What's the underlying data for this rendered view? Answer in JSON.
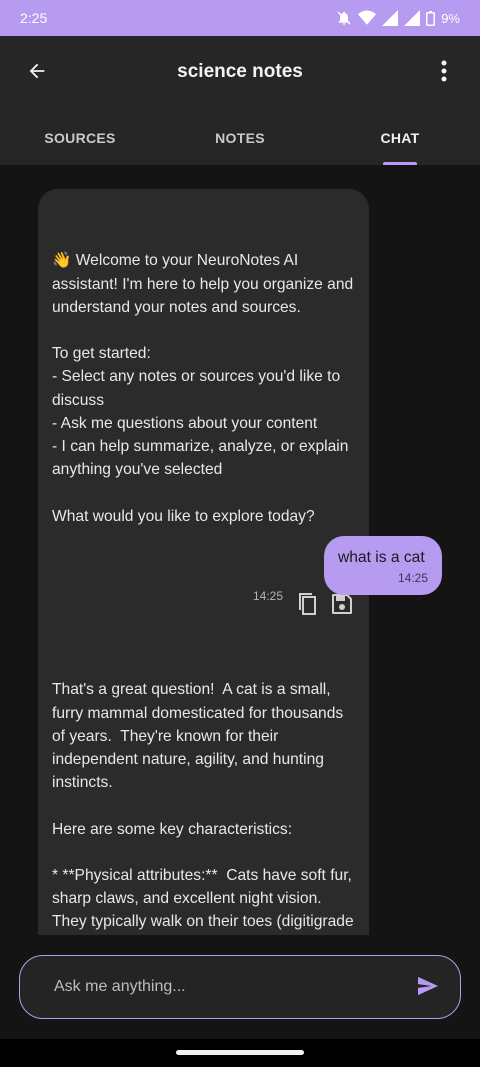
{
  "status_bar": {
    "time": "2:25",
    "battery": "9%"
  },
  "app_bar": {
    "title": "science notes",
    "back_icon": "arrow-back-icon",
    "menu_icon": "more-vert-icon"
  },
  "tabs": [
    {
      "label": "SOURCES",
      "active": false
    },
    {
      "label": "NOTES",
      "active": false
    },
    {
      "label": "CHAT",
      "active": true
    }
  ],
  "messages": [
    {
      "role": "assistant",
      "text": "👋 Welcome to your NeuroNotes AI assistant! I'm here to help you organize and understand your notes and sources.\n\nTo get started:\n- Select any notes or sources you'd like to discuss\n- Ask me questions about your content\n- I can help summarize, analyze, or explain anything you've selected\n\nWhat would you like to explore today?",
      "time": "14:25",
      "actions": [
        "copy-icon",
        "save-icon"
      ]
    },
    {
      "role": "user",
      "text": "what is a cat",
      "time": "14:25"
    },
    {
      "role": "assistant",
      "text": "That's a great question!  A cat is a small, furry mammal domesticated for thousands of years.  They're known for their independent nature, agility, and hunting instincts.\n\nHere are some key characteristics:\n\n* **Physical attributes:**  Cats have soft fur, sharp claws, and excellent night vision.  They typically walk on their toes (digitigrade locomotion).\n* **Behavior:** Cats are often described"
    }
  ],
  "input": {
    "placeholder": "Ask me anything...",
    "value": "",
    "send_icon": "send-icon"
  },
  "colors": {
    "accent": "#b79bf0",
    "bubble_ai": "#2b2b2b",
    "background": "#141414",
    "app_bar": "#262626"
  }
}
